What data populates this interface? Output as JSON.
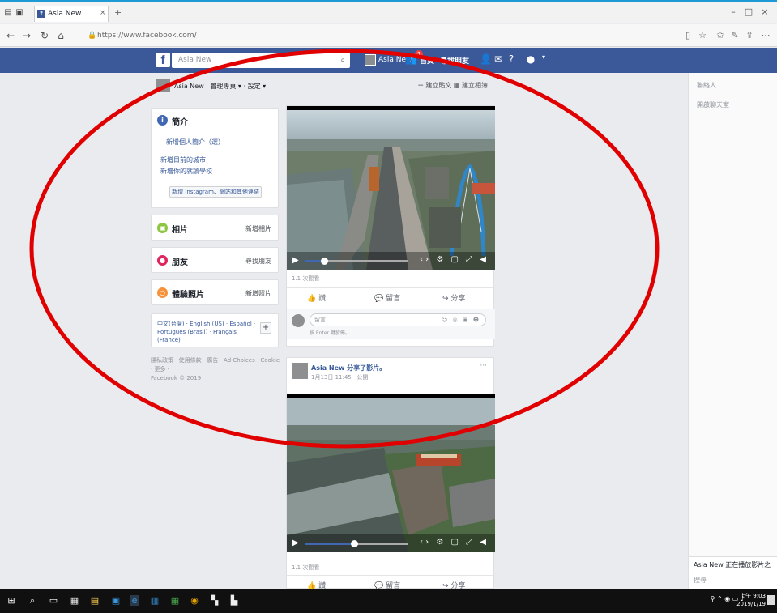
{
  "browser": {
    "tab_title": "Asia New",
    "url": "https://www.facebook.com/",
    "back": "←",
    "forward": "→",
    "refresh": "↻",
    "home": "⌂"
  },
  "fb": {
    "search_placeholder": "Asia New",
    "user_name": "Asia New",
    "home_label": "首頁",
    "find_friends_label": "尋找朋友",
    "notification_count": "1"
  },
  "page_header": {
    "name": "Asia New · 管理專頁 ▾ · 設定 ▾",
    "actions": "☰ 建立貼文   ▦ 建立相簿"
  },
  "left": {
    "intro_title": "簡介",
    "intro_line": "新增個人簡介（選）",
    "intro_row1": "新增目前的城市",
    "intro_row2": "新增你的就讀學校",
    "instagram_button": "新增 Instagram、網站和其他連結",
    "photos_title": "相片",
    "photos_link": "新增相片",
    "friends_title": "朋友",
    "friends_link": "尋找朋友",
    "places_title": "體驗照片",
    "places_link": "新增照片",
    "languages": "中文(台灣) · English (US) · Español · Português (Brasil) · Français (France)",
    "footer": "隱私政策 · 使用條款 · 廣告 · Ad Choices · Cookie · 更多 ·",
    "copyright": "Facebook © 2019"
  },
  "post1": {
    "views": "1.1 次觀看",
    "like": "讚",
    "comment": "留言",
    "share": "分享",
    "comment_placeholder": "留言……",
    "comment_hint": "按 Enter 鍵發佈。",
    "progress": 0.18
  },
  "post2": {
    "author": "Asia New 分享了影片。",
    "time": "1月13日 11:45 · 公開",
    "more": "···",
    "views": "1.1 次觀看",
    "like": "讚",
    "comment": "留言",
    "share": "分享",
    "progress": 0.47
  },
  "right_rail": {
    "heading": "聯絡人",
    "item": "開啟聊天室",
    "bottom1": "Asia New 正在播放影片之一",
    "bottom2": "搜尋"
  },
  "taskbar": {
    "clock_time": "上午 9:03",
    "clock_date": "2019/1/19"
  },
  "colors": {
    "facebook_blue": "#3b5998",
    "annotation_red": "#e00000",
    "taskbar": "#101010"
  }
}
